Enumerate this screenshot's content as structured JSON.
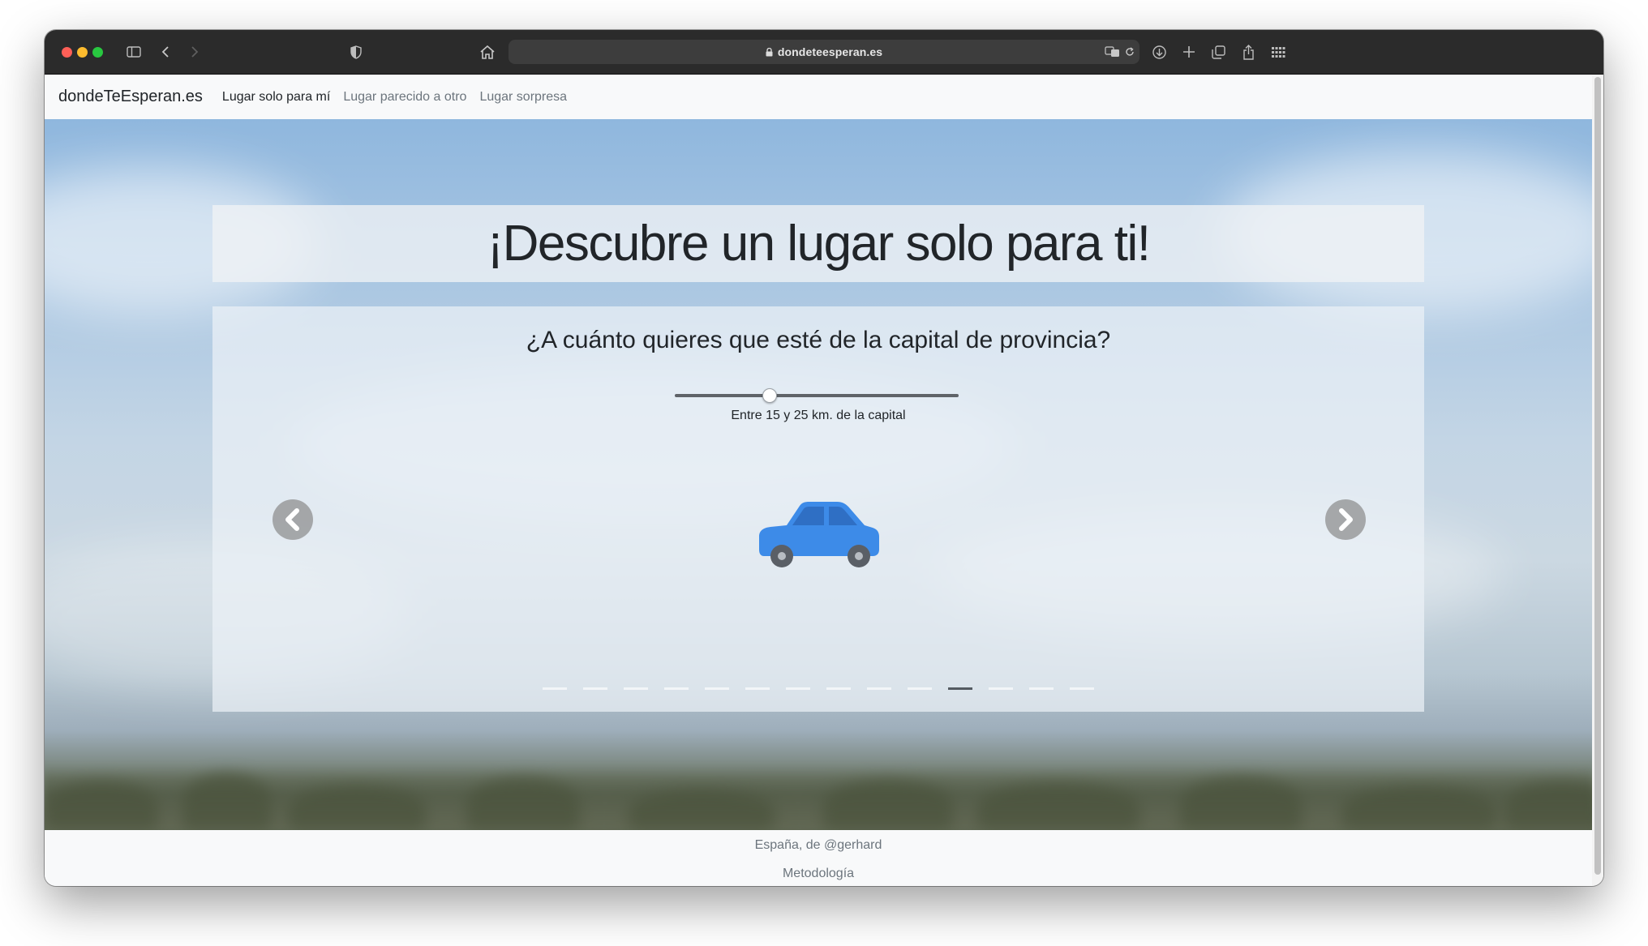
{
  "browser": {
    "url": "dondeteesperan.es",
    "icons": [
      "sidebar-icon",
      "back-icon",
      "forward-icon",
      "shield-icon",
      "home-icon",
      "lock-icon",
      "translate-icon",
      "reload-icon",
      "download-icon",
      "new-tab-icon",
      "tabs-overview-icon",
      "share-icon",
      "grid-icon"
    ]
  },
  "navbar": {
    "brand": "dondeTeEsperan.es",
    "links": [
      {
        "label": "Lugar solo para mí",
        "active": true
      },
      {
        "label": "Lugar parecido a otro",
        "active": false
      },
      {
        "label": "Lugar sorpresa",
        "active": false
      }
    ]
  },
  "hero": {
    "title": "¡Descubre un lugar solo para ti!"
  },
  "carousel": {
    "question": "¿A cuánto quieres que esté de la capital de provincia?",
    "slider_value_fraction": 0.33,
    "slider_caption": "Entre 15 y 25 km. de la capital",
    "image_icon": "car-icon",
    "car_color": "#3d8be8",
    "indicator_count": 14,
    "active_indicator": 10
  },
  "footer": {
    "credit": "España, de @gerhard",
    "methodology": "Metodología"
  }
}
